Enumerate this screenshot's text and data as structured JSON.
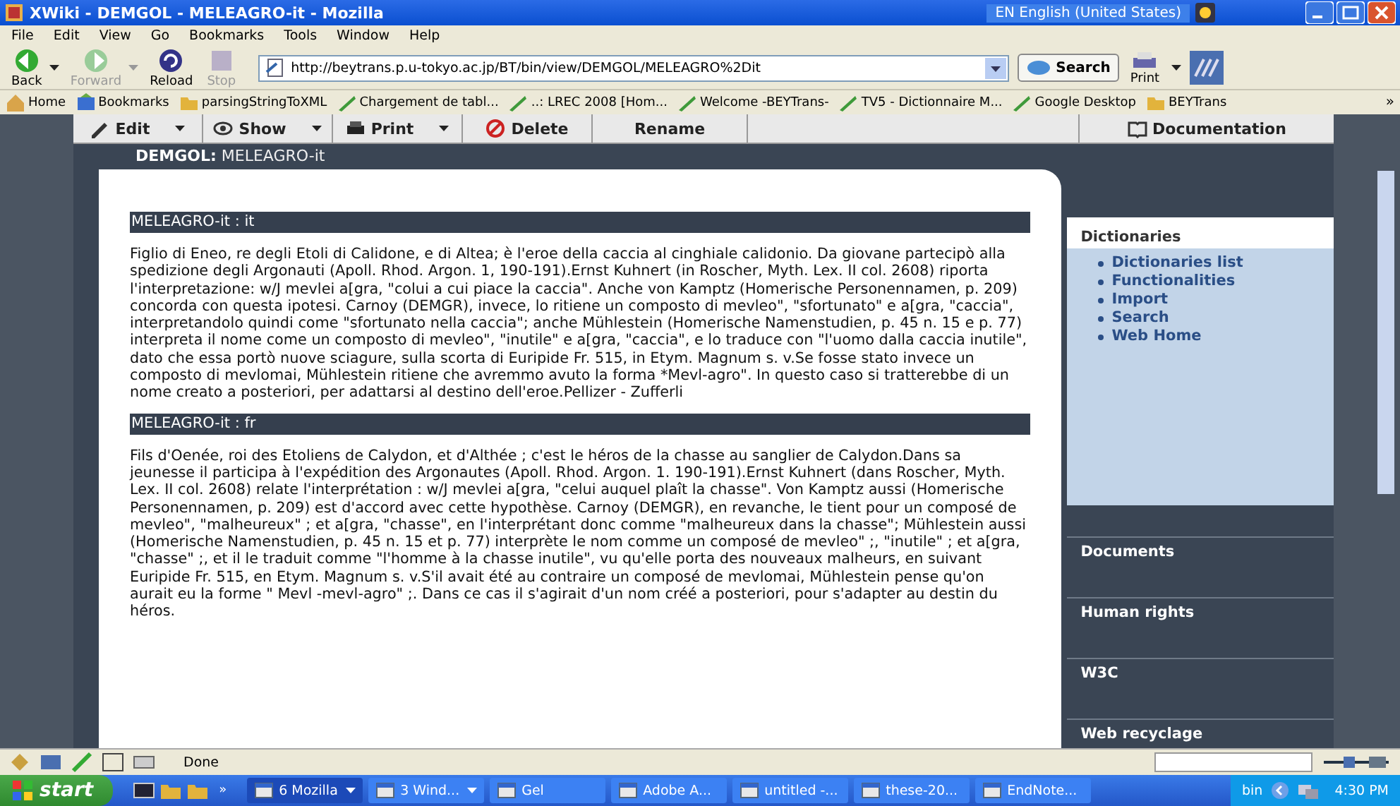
{
  "window": {
    "title": "XWiki - DEMGOL - MELEAGRO-it - Mozilla",
    "language": "EN English (United States)"
  },
  "menu": [
    "File",
    "Edit",
    "View",
    "Go",
    "Bookmarks",
    "Tools",
    "Window",
    "Help"
  ],
  "nav_buttons": [
    {
      "label": "Back",
      "disabled": false,
      "dropdown": true
    },
    {
      "label": "Forward",
      "disabled": true,
      "dropdown": true
    },
    {
      "label": "Reload",
      "disabled": false,
      "dropdown": false
    },
    {
      "label": "Stop",
      "disabled": true,
      "dropdown": false
    }
  ],
  "address": {
    "value": "http://beytrans.p.u-tokyo.ac.jp/BT/bin/view/DEMGOL/MELEAGRO%2Dit"
  },
  "search_button": "Search",
  "print_button": "Print",
  "bookmarks": [
    {
      "label": "Home",
      "kind": "home"
    },
    {
      "label": "Bookmarks",
      "kind": "bookmarks"
    },
    {
      "label": "parsingStringToXML",
      "kind": "folder"
    },
    {
      "label": "Chargement de tabl...",
      "kind": "page"
    },
    {
      "label": "..: LREC 2008 [Hom...",
      "kind": "page"
    },
    {
      "label": "Welcome -BEYTrans-",
      "kind": "page"
    },
    {
      "label": "TV5 - Dictionnaire M...",
      "kind": "page"
    },
    {
      "label": "Google Desktop",
      "kind": "page"
    },
    {
      "label": "BEYTrans",
      "kind": "folder"
    }
  ],
  "bookmarks_more": "»",
  "page_actions": [
    {
      "label": "Edit",
      "kind": "pencil",
      "dropdown": true
    },
    {
      "label": "Show",
      "kind": "eye",
      "dropdown": true
    },
    {
      "label": "Print",
      "kind": "printer",
      "dropdown": true
    },
    {
      "label": "Delete",
      "kind": "stop",
      "dropdown": false
    },
    {
      "label": "Rename",
      "kind": "none",
      "dropdown": false
    }
  ],
  "documentation": "Documentation",
  "breadcrumb": {
    "space": "DEMGOL:",
    "page": "MELEAGRO-it"
  },
  "sections": [
    {
      "heading": "MELEAGRO-it : it",
      "text": "Figlio di Eneo, re degli Etoli di Calidone, e di Altea; è l'eroe della caccia al cinghiale calidonio. Da giovane partecipò alla spedizione degli Argonauti (Apoll. Rhod. Argon. 1, 190-191).Ernst Kuhnert (in Roscher, Myth. Lex. II col. 2608) riporta l'interpretazione: w/J mevlei a[gra, \"colui a cui piace la caccia\". Anche von Kamptz (Homerische Personennamen, p. 209) concorda con questa ipotesi. Carnoy (DEMGR), invece, lo ritiene un composto di mevleo\", \"sfortunato\" e a[gra, \"caccia\", interpretandolo quindi come \"sfortunato nella caccia\"; anche Mühlestein (Homerische Namenstudien, p. 45 n. 15 e p. 77) interpreta il nome come un composto di mevleo\", \"inutile\" e a[gra, \"caccia\", e lo traduce con \"l'uomo dalla caccia inutile\", dato che essa portò nuove sciagure, sulla scorta di Euripide Fr. 515, in Etym. Magnum s. v.Se fosse stato invece un composto di mevlomai, Mühlestein ritiene che avremmo avuto la forma *Mevl-agro\". In questo caso si tratterebbe di un nome creato a posteriori, per adattarsi al destino dell'eroe.Pellizer - Zufferli"
    },
    {
      "heading": "MELEAGRO-it : fr",
      "text": "Fils d'Oenée, roi des Etoliens de Calydon, et d'Althée ; c'est le héros de la chasse au sanglier de Calydon.Dans sa jeunesse il participa à l'expédition des Argonautes (Apoll. Rhod. Argon. 1. 190-191).Ernst Kuhnert (dans Roscher, Myth. Lex. II col. 2608) relate l'interprétation : w/J mevlei a[gra, \"celui auquel plaît la chasse\". Von Kamptz aussi (Homerische Personennamen, p. 209) est d'accord avec cette hypothèse. Carnoy (DEMGR), en revanche, le tient pour un composé de mevleo\", \"malheureux\" ; et a[gra, \"chasse\", en l'interprétant donc comme \"malheureux dans la chasse\"; Mühlestein aussi (Homerische Namenstudien, p. 45 n. 15 et p. 77) interprète le nom comme un composé de mevleo\" ;, \"inutile\" ; et a[gra, \"chasse\" ;, et il le traduit comme \"l'homme à la chasse inutile\", vu qu'elle porta des nouveaux malheurs, en suivant Euripide Fr. 515, en Etym. Magnum s. v.S'il avait été au contraire un composé de mevlomai, Mühlestein pense qu'on aurait eu la forme \" Mevl -mevl-agro\" ;. Dans ce cas il s'agirait d'un nom créé a posteriori, pour s'adapter au destin du héros."
    }
  ],
  "sidebar": {
    "panel": {
      "title": "Dictionaries",
      "links": [
        "Dictionaries list",
        "Functionalities",
        "Import",
        "Search",
        "Web Home"
      ]
    },
    "headings": [
      "Documents",
      "Human rights",
      "W3C",
      "Web recyclage"
    ]
  },
  "status_bar": {
    "text": "Done"
  },
  "taskbar": {
    "start": "start",
    "more": "»",
    "tasks": [
      {
        "label": "6 Mozilla",
        "selected": true,
        "dropdown": true
      },
      {
        "label": "3 Wind...",
        "selected": false,
        "dropdown": true
      },
      {
        "label": "Gel",
        "selected": false,
        "dropdown": false
      },
      {
        "label": "Adobe A...",
        "selected": false,
        "dropdown": false
      },
      {
        "label": "untitled -...",
        "selected": false,
        "dropdown": false
      },
      {
        "label": "these-20...",
        "selected": false,
        "dropdown": false
      },
      {
        "label": "EndNote...",
        "selected": false,
        "dropdown": false
      }
    ],
    "tray_label": "bin",
    "clock": "4:30 PM"
  }
}
